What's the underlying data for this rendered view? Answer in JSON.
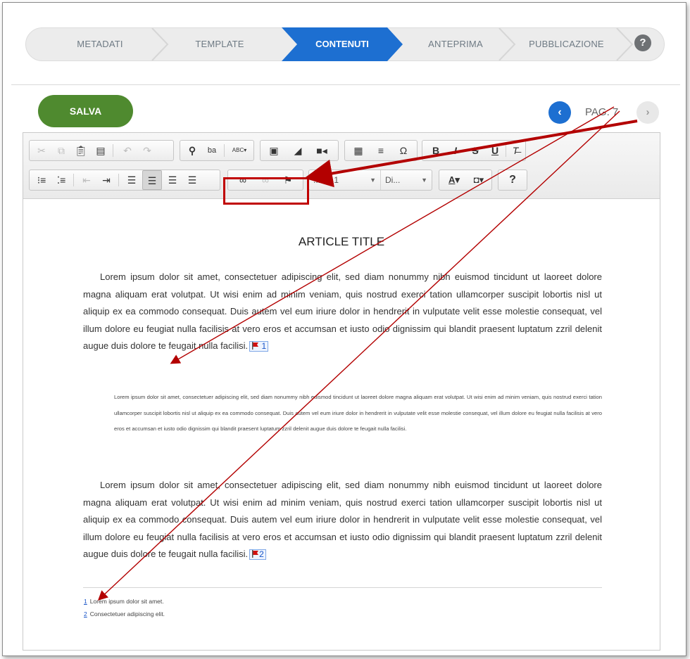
{
  "wizard": {
    "steps": [
      {
        "label": "METADATI",
        "active": false
      },
      {
        "label": "TEMPLATE",
        "active": false
      },
      {
        "label": "CONTENUTI",
        "active": true
      },
      {
        "label": "ANTEPRIMA",
        "active": false
      },
      {
        "label": "PUBBLICAZIONE",
        "active": false
      }
    ],
    "help": "?"
  },
  "save_label": "SALVA",
  "pager": {
    "prev": "‹",
    "label": "PAG. 7",
    "next": "›"
  },
  "toolbar": {
    "format_combo": "...olo 1",
    "font_combo": "Di...",
    "font_color": "A",
    "bg_color": "◘",
    "help": "?"
  },
  "article": {
    "title": "ARTICLE TITLE",
    "para1": "Lorem ipsum dolor sit amet, consectetuer adipiscing elit, sed diam nonummy nibh euismod tincidunt ut laoreet dolore magna aliquam erat volutpat. Ut wisi enim ad minim veniam, quis nostrud exerci tation ullamcorper suscipit lobortis nisl ut aliquip ex ea commodo consequat. Duis autem vel eum iriure dolor in hendrerit in vulputate velit esse molestie consequat, vel illum dolore eu feugiat nulla facilisis at vero eros et accumsan et iusto odio dignissim qui blandit praesent luptatum zzril delenit augue duis dolore te feugait nulla facilisi.",
    "fn_marker_1": "1",
    "quote": "Lorem ipsum dolor sit amet, consectetuer adipiscing elit, sed diam nonummy nibh euismod tincidunt ut laoreet dolore magna aliquam erat volutpat. Ut wisi enim ad minim veniam, quis nostrud exerci tation ullamcorper suscipit lobortis nisl ut aliquip ex ea commodo consequat. Duis autem vel eum iriure dolor in hendrerit in vulputate velit esse molestie consequat, vel illum dolore eu feugiat nulla facilisis at vero eros et accumsan et iusto odio dignissim qui blandit praesent luptatum zzril delenit augue duis dolore te feugait nulla facilisi.",
    "para2": "Lorem ipsum dolor sit amet, consectetuer adipiscing elit, sed diam nonummy nibh euismod tincidunt ut laoreet dolore magna aliquam erat volutpat. Ut wisi enim ad minim veniam, quis nostrud exerci tation ullamcorper suscipit lobortis nisl ut aliquip ex ea commodo consequat. Duis autem vel eum iriure dolor in hendrerit in vulputate velit esse molestie consequat, vel illum dolore eu feugiat nulla facilisis at vero eros et accumsan et iusto odio dignissim qui blandit praesent luptatum zzril delenit augue duis dolore te feugait nulla facilisi.",
    "fn_marker_2": "2",
    "footnotes": [
      {
        "num": "1",
        "text": "Lorem ipsum dolor sit amet."
      },
      {
        "num": "2",
        "text": "Consectetuer adipiscing elit."
      }
    ]
  },
  "colors": {
    "active_step": "#1d6fd1",
    "save": "#4f8a2f",
    "annotation": "#b30000"
  },
  "icons": [
    "cut-icon",
    "copy-icon",
    "paste-icon",
    "paste-text-icon",
    "undo-icon",
    "redo-icon",
    "find-icon",
    "replace-icon",
    "spellcheck-icon",
    "image-icon",
    "flash-icon",
    "video-icon",
    "table-icon",
    "horizontal-rule-icon",
    "special-char-icon",
    "bold-icon",
    "italic-icon",
    "strike-icon",
    "underline-icon",
    "remove-format-icon",
    "numbered-list-icon",
    "bulleted-list-icon",
    "outdent-icon",
    "indent-icon",
    "align-left-icon",
    "align-center-icon",
    "align-right-icon",
    "justify-icon",
    "link-icon",
    "unlink-icon",
    "footnote-flag-icon"
  ]
}
